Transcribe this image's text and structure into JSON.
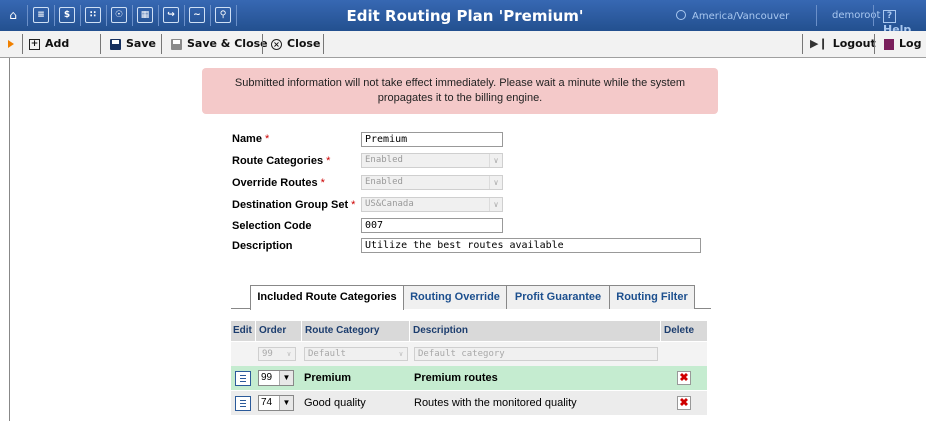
{
  "topbar": {
    "title": "Edit Routing Plan 'Premium'",
    "timezone": "America/Vancouver",
    "user": "demoroot",
    "help": "Help",
    "icons": [
      "home-icon",
      "list-icon",
      "dollar-icon",
      "grid-icon",
      "person-icon",
      "network-icon",
      "arrow-icon",
      "chart-icon",
      "search-icon"
    ]
  },
  "toolbar": {
    "add": "Add",
    "save": "Save",
    "save_close": "Save & Close",
    "close": "Close",
    "logout": "Logout",
    "log": "Log"
  },
  "notice": {
    "line1": "Submitted information will not take effect immediately. Please wait a minute while the system",
    "line2": "propagates it to the billing engine."
  },
  "form": {
    "name_label": "Name",
    "name_value": "Premium",
    "route_categories_label": "Route Categories",
    "route_categories_value": "Enabled",
    "override_routes_label": "Override Routes",
    "override_routes_value": "Enabled",
    "destination_group_set_label": "Destination Group Set",
    "destination_group_set_value": "US&Canada",
    "selection_code_label": "Selection Code",
    "selection_code_value": "007",
    "description_label": "Description",
    "description_value": "Utilize the best routes available",
    "required_mark": "*"
  },
  "tabs": {
    "included": "Included Route Categories",
    "override": "Routing Override",
    "profit": "Profit Guarantee",
    "filter": "Routing Filter"
  },
  "table": {
    "headers": {
      "edit": "Edit",
      "order": "Order",
      "route_category": "Route Category",
      "description": "Description",
      "delete": "Delete"
    },
    "new_row": {
      "order": "99",
      "category": "Default",
      "description": "Default category"
    },
    "rows": [
      {
        "order": "99",
        "category": "Premium",
        "description": "Premium routes"
      },
      {
        "order": "74",
        "category": "Good quality",
        "description": "Routes with the monitored quality"
      }
    ]
  },
  "colors": {
    "topbar": "#2c5aa0",
    "notice_bg": "#f4c9c9",
    "highlight_row": "#c5ecd0",
    "required": "#cc0000"
  }
}
